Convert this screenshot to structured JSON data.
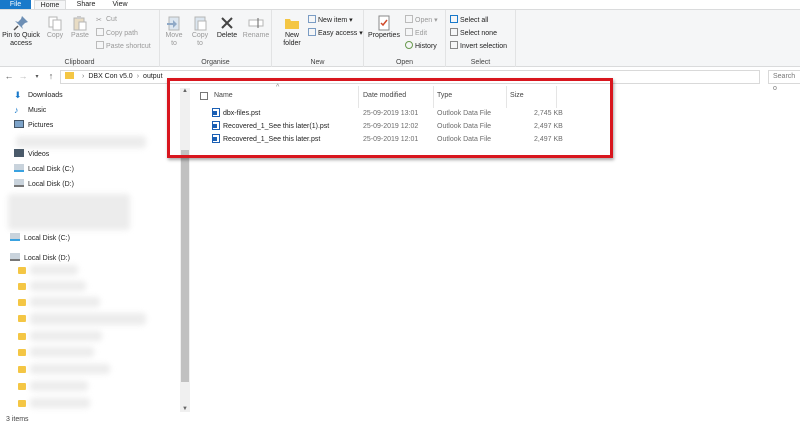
{
  "tabs": {
    "file": "File",
    "home": "Home",
    "share": "Share",
    "view": "View"
  },
  "ribbon": {
    "clipboard": {
      "label": "Clipboard",
      "pin": "Pin to Quick access",
      "copy": "Copy",
      "paste": "Paste",
      "cut": "Cut",
      "copy_path": "Copy path",
      "paste_shortcut": "Paste shortcut"
    },
    "organise": {
      "label": "Organise",
      "move_to": "Move to",
      "copy_to": "Copy to",
      "delete": "Delete",
      "rename": "Rename"
    },
    "new": {
      "label": "New",
      "new_folder": "New folder",
      "new_item": "New item",
      "easy_access": "Easy access"
    },
    "open": {
      "label": "Open",
      "properties": "Properties",
      "open": "Open",
      "edit": "Edit",
      "history": "History"
    },
    "select": {
      "label": "Select",
      "select_all": "Select all",
      "select_none": "Select none",
      "invert": "Invert selection"
    }
  },
  "address": {
    "path": [
      "DBX Con v5.0",
      "output"
    ],
    "search_placeholder": "Search o"
  },
  "nav": {
    "items": [
      {
        "label": "Downloads",
        "icon": "download-arrow-icon"
      },
      {
        "label": "Music",
        "icon": "music-note-icon"
      },
      {
        "label": "Pictures",
        "icon": "pictures-icon"
      },
      {
        "label": "Videos",
        "icon": "videos-icon"
      },
      {
        "label": "Local Disk (C:)",
        "icon": "drive-icon"
      },
      {
        "label": "Local Disk (D:)",
        "icon": "drive-icon"
      },
      {
        "label": "Local Disk (C:)",
        "icon": "drive-icon"
      },
      {
        "label": "Local Disk (D:)",
        "icon": "drive-icon"
      }
    ]
  },
  "columns": {
    "name": "Name",
    "date": "Date modified",
    "type": "Type",
    "size": "Size"
  },
  "files": [
    {
      "name": "dbx-files.pst",
      "date": "25-09-2019 13:01",
      "type": "Outlook Data File",
      "size": "2,745 KB"
    },
    {
      "name": "Recovered_1_See this later(1).pst",
      "date": "25-09-2019 12:02",
      "type": "Outlook Data File",
      "size": "2,497 KB"
    },
    {
      "name": "Recovered_1_See this later.pst",
      "date": "25-09-2019 12:01",
      "type": "Outlook Data File",
      "size": "2,497 KB"
    }
  ],
  "status": "3 items",
  "colors": {
    "accent": "#1979ca",
    "highlight": "#d8161e",
    "folder": "#f4c644"
  }
}
